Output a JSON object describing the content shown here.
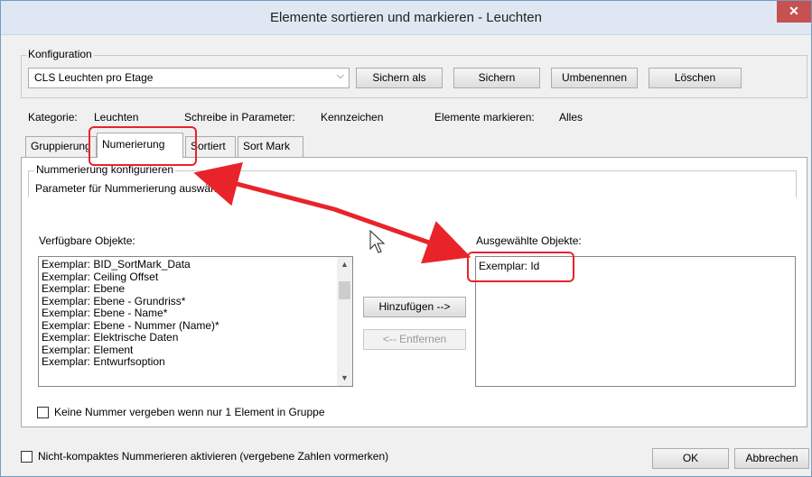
{
  "window": {
    "title": "Elemente sortieren und markieren - Leuchten",
    "close": "✕"
  },
  "config": {
    "legend": "Konfiguration",
    "selected": "CLS Leuchten pro Etage",
    "buttons": {
      "save_as": "Sichern als",
      "save": "Sichern",
      "rename": "Umbenennen",
      "delete": "Löschen"
    }
  },
  "info": {
    "category_label": "Kategorie:",
    "category_value": "Leuchten",
    "param_label": "Schreibe in Parameter:",
    "param_value": "Kennzeichen",
    "mark_label": "Elemente markieren:",
    "mark_value": "Alles"
  },
  "tabs": [
    {
      "label": "Gruppierung"
    },
    {
      "label": "Numerierung"
    },
    {
      "label": "Sortiert"
    },
    {
      "label": "Sort Mark"
    }
  ],
  "numbering": {
    "legend": "Nummerierung konfigurieren",
    "hint": "Parameter für Nummerierung auswählen",
    "available_label": "Verfügbare Objekte:",
    "selected_label": "Ausgewählte Objekte:",
    "available_items": [
      "Exemplar: BID_SortMark_Data",
      "Exemplar: Ceiling Offset",
      "Exemplar: Ebene",
      "Exemplar: Ebene - Grundriss*",
      "Exemplar: Ebene - Name*",
      "Exemplar: Ebene - Nummer (Name)*",
      "Exemplar: Elektrische Daten",
      "Exemplar: Element",
      "Exemplar: Entwurfsoption"
    ],
    "selected_items": [
      "Exemplar: Id"
    ],
    "add_button": "Hinzufügen -->",
    "remove_button": "<-- Entfernen",
    "single_checkbox_label": "Keine Nummer vergeben wenn nur 1 Element in Gruppe"
  },
  "footer": {
    "compact_checkbox_label": "Nicht-kompaktes Nummerieren aktivieren (vergebene Zahlen vormerken)",
    "ok": "OK",
    "cancel": "Abbrechen"
  },
  "annotation_color": "#e8242a"
}
